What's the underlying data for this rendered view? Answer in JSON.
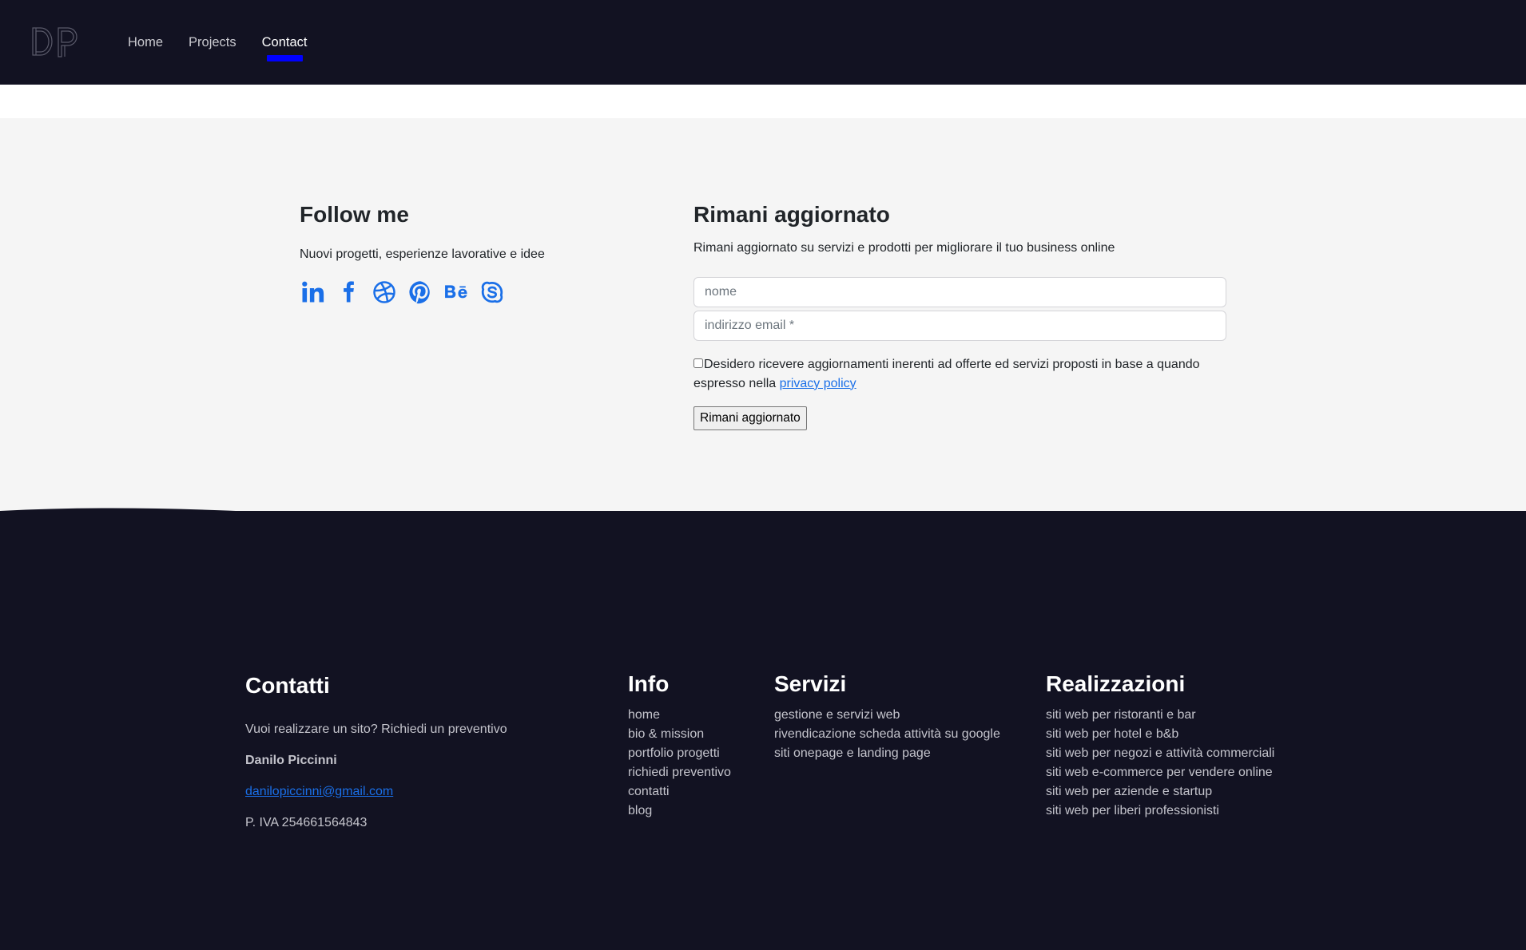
{
  "nav": {
    "logo": "DP",
    "items": [
      {
        "label": "Home",
        "active": false
      },
      {
        "label": "Projects",
        "active": false
      },
      {
        "label": "Contact",
        "active": true
      }
    ],
    "accent": "#0000ff"
  },
  "follow": {
    "title": "Follow me",
    "subtitle": "Nuovi progetti, esperienze lavorative e idee",
    "socials": [
      "linkedin-icon",
      "facebook-icon",
      "dribbble-icon",
      "pinterest-icon",
      "behance-icon",
      "skype-icon"
    ]
  },
  "newsletter": {
    "title": "Rimani aggiornato",
    "subtitle": "Rimani aggiornato su servizi e prodotti per migliorare il tuo business online",
    "name_placeholder": "nome",
    "email_placeholder": "indirizzo email *",
    "consent_text": "Desidero ricevere aggiornamenti inerenti ad offerte ed servizi proposti in base a quando espresso nella ",
    "privacy_link": "privacy policy",
    "submit_label": "Rimani aggiornato"
  },
  "footer": {
    "contacts": {
      "title": "Contatti",
      "cta": "Vuoi realizzare un sito? Richiedi un preventivo",
      "name": "Danilo Piccinni",
      "email": "danilopiccinni@gmail.com",
      "vat": "P. IVA 254661564843"
    },
    "info": {
      "title": "Info",
      "links": [
        "home",
        "bio & mission",
        "portfolio progetti",
        "richiedi preventivo",
        "contatti",
        "blog"
      ]
    },
    "servizi": {
      "title": "Servizi",
      "links": [
        "gestione e servizi web",
        "rivendicazione scheda attività su google",
        "siti onepage e landing page"
      ]
    },
    "realizzazioni": {
      "title": "Realizzazioni",
      "links": [
        "siti web per ristoranti e bar",
        "siti web per hotel e b&b",
        "siti web per negozi e attività commerciali",
        "siti web e-commerce per vendere online",
        "siti web per aziende e startup",
        "siti web per liberi professionisti"
      ]
    }
  },
  "colors": {
    "dark": "#121222",
    "link": "#1a6fe8",
    "background": "#f5f5f5"
  }
}
